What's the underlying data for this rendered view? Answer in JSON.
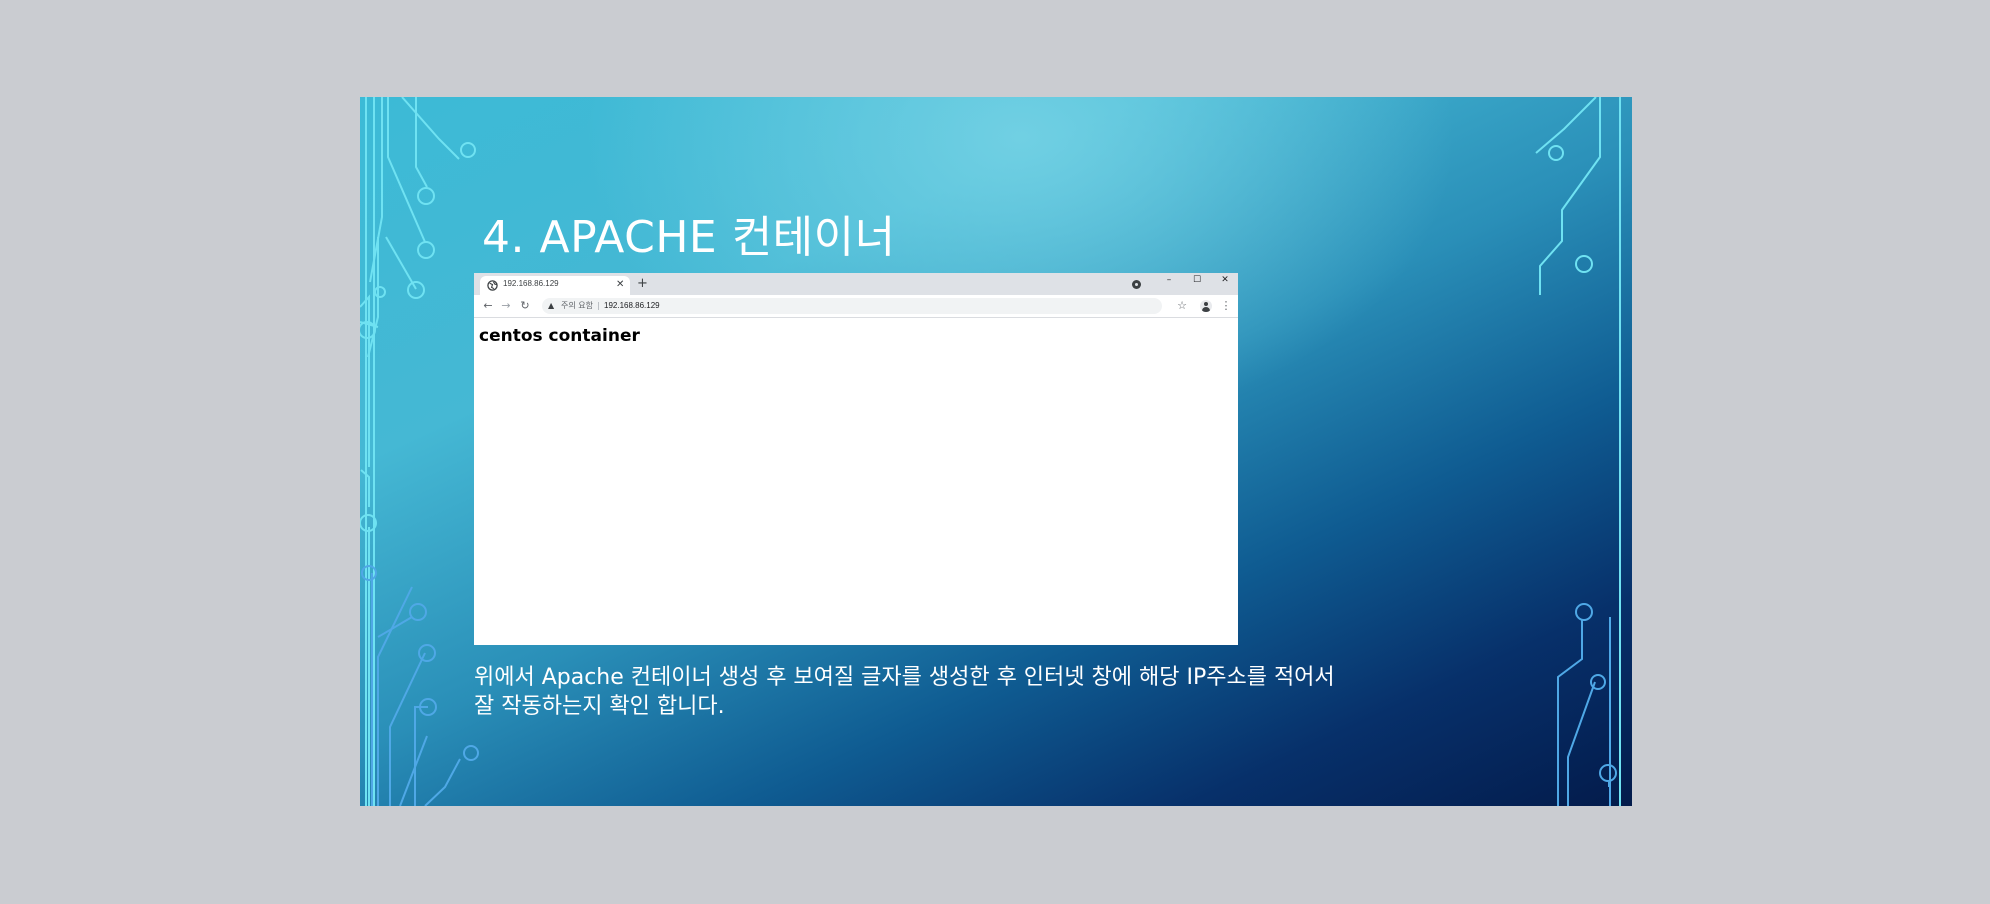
{
  "slide": {
    "title": "4. APACHE 컨테이너",
    "caption_line1": "위에서 Apache 컨테이너 생성 후 보여질 글자를 생성한 후 인터넷 창에 해당 IP주소를 적어서",
    "caption_line2": "잘 작동하는지 확인 합니다."
  },
  "browser": {
    "tab": {
      "title": "192.168.86.129",
      "close_glyph": "✕",
      "favicon": "globe-icon"
    },
    "new_tab_glyph": "+",
    "window_controls": {
      "minimize": "–",
      "maximize": "☐",
      "close": "✕"
    },
    "nav": {
      "back": "←",
      "forward": "→",
      "reload": "↻"
    },
    "address_bar": {
      "security_label": "주의 요함",
      "url": "192.168.86.129",
      "warning_icon": "warning-icon"
    },
    "toolbar_right": {
      "bookmark": "☆",
      "menu": "⋮"
    },
    "page": {
      "heading": "centos container"
    }
  },
  "colors": {
    "slide_light": "#45b8d4",
    "slide_dark": "#031b4b",
    "circuit_line": "#6ee0f0",
    "tabstrip": "#dee1e6"
  }
}
